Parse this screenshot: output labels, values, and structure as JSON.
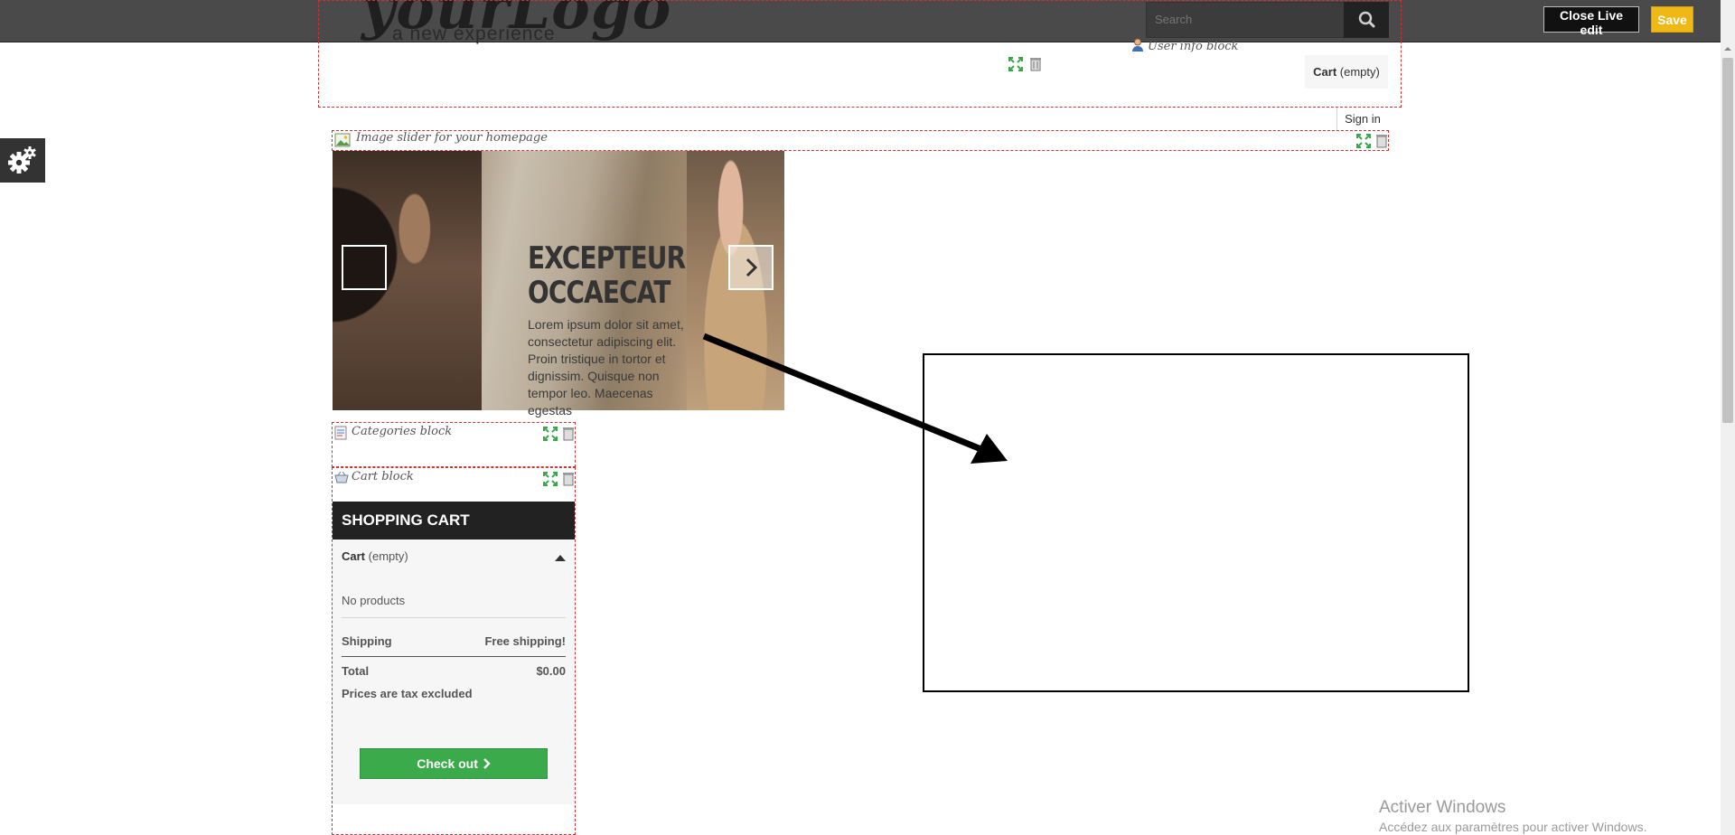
{
  "topbar": {
    "logo_text": "yourLogo",
    "logo_tagline": "a new experience",
    "search_placeholder": "Search",
    "close_live_edit_label": "Close Live edit",
    "save_label": "Save"
  },
  "header": {
    "user_info_label": "User info block",
    "cart_label": "Cart",
    "cart_status": "(empty)",
    "sign_in_label": "Sign in"
  },
  "slider_module": {
    "label": "Image slider for your homepage",
    "title_line1": "EXCEPTEUR",
    "title_line2": "OCCAECAT",
    "text": "Lorem ipsum dolor sit amet, consectetur adipiscing elit. Proin tristique in tortor et dignissim. Quisque non tempor leo. Maecenas egestas"
  },
  "categories_module": {
    "label": "Categories block"
  },
  "cart_module": {
    "label": "Cart block",
    "heading": "SHOPPING CART",
    "cart_label": "Cart",
    "cart_status": "(empty)",
    "no_products": "No products",
    "shipping_label": "Shipping",
    "shipping_value": "Free shipping!",
    "total_label": "Total",
    "total_value": "$0.00",
    "tax_note": "Prices are tax excluded",
    "checkout_label": "Check out"
  },
  "watermark": {
    "title": "Activer Windows",
    "subtitle": "Accédez aux paramètres pour activer Windows."
  },
  "colors": {
    "topbar": "#4a4a4a",
    "save": "#f0b815",
    "checkout": "#3aaa4b",
    "module_outline": "#cc3333",
    "cart_heading": "#222222"
  }
}
